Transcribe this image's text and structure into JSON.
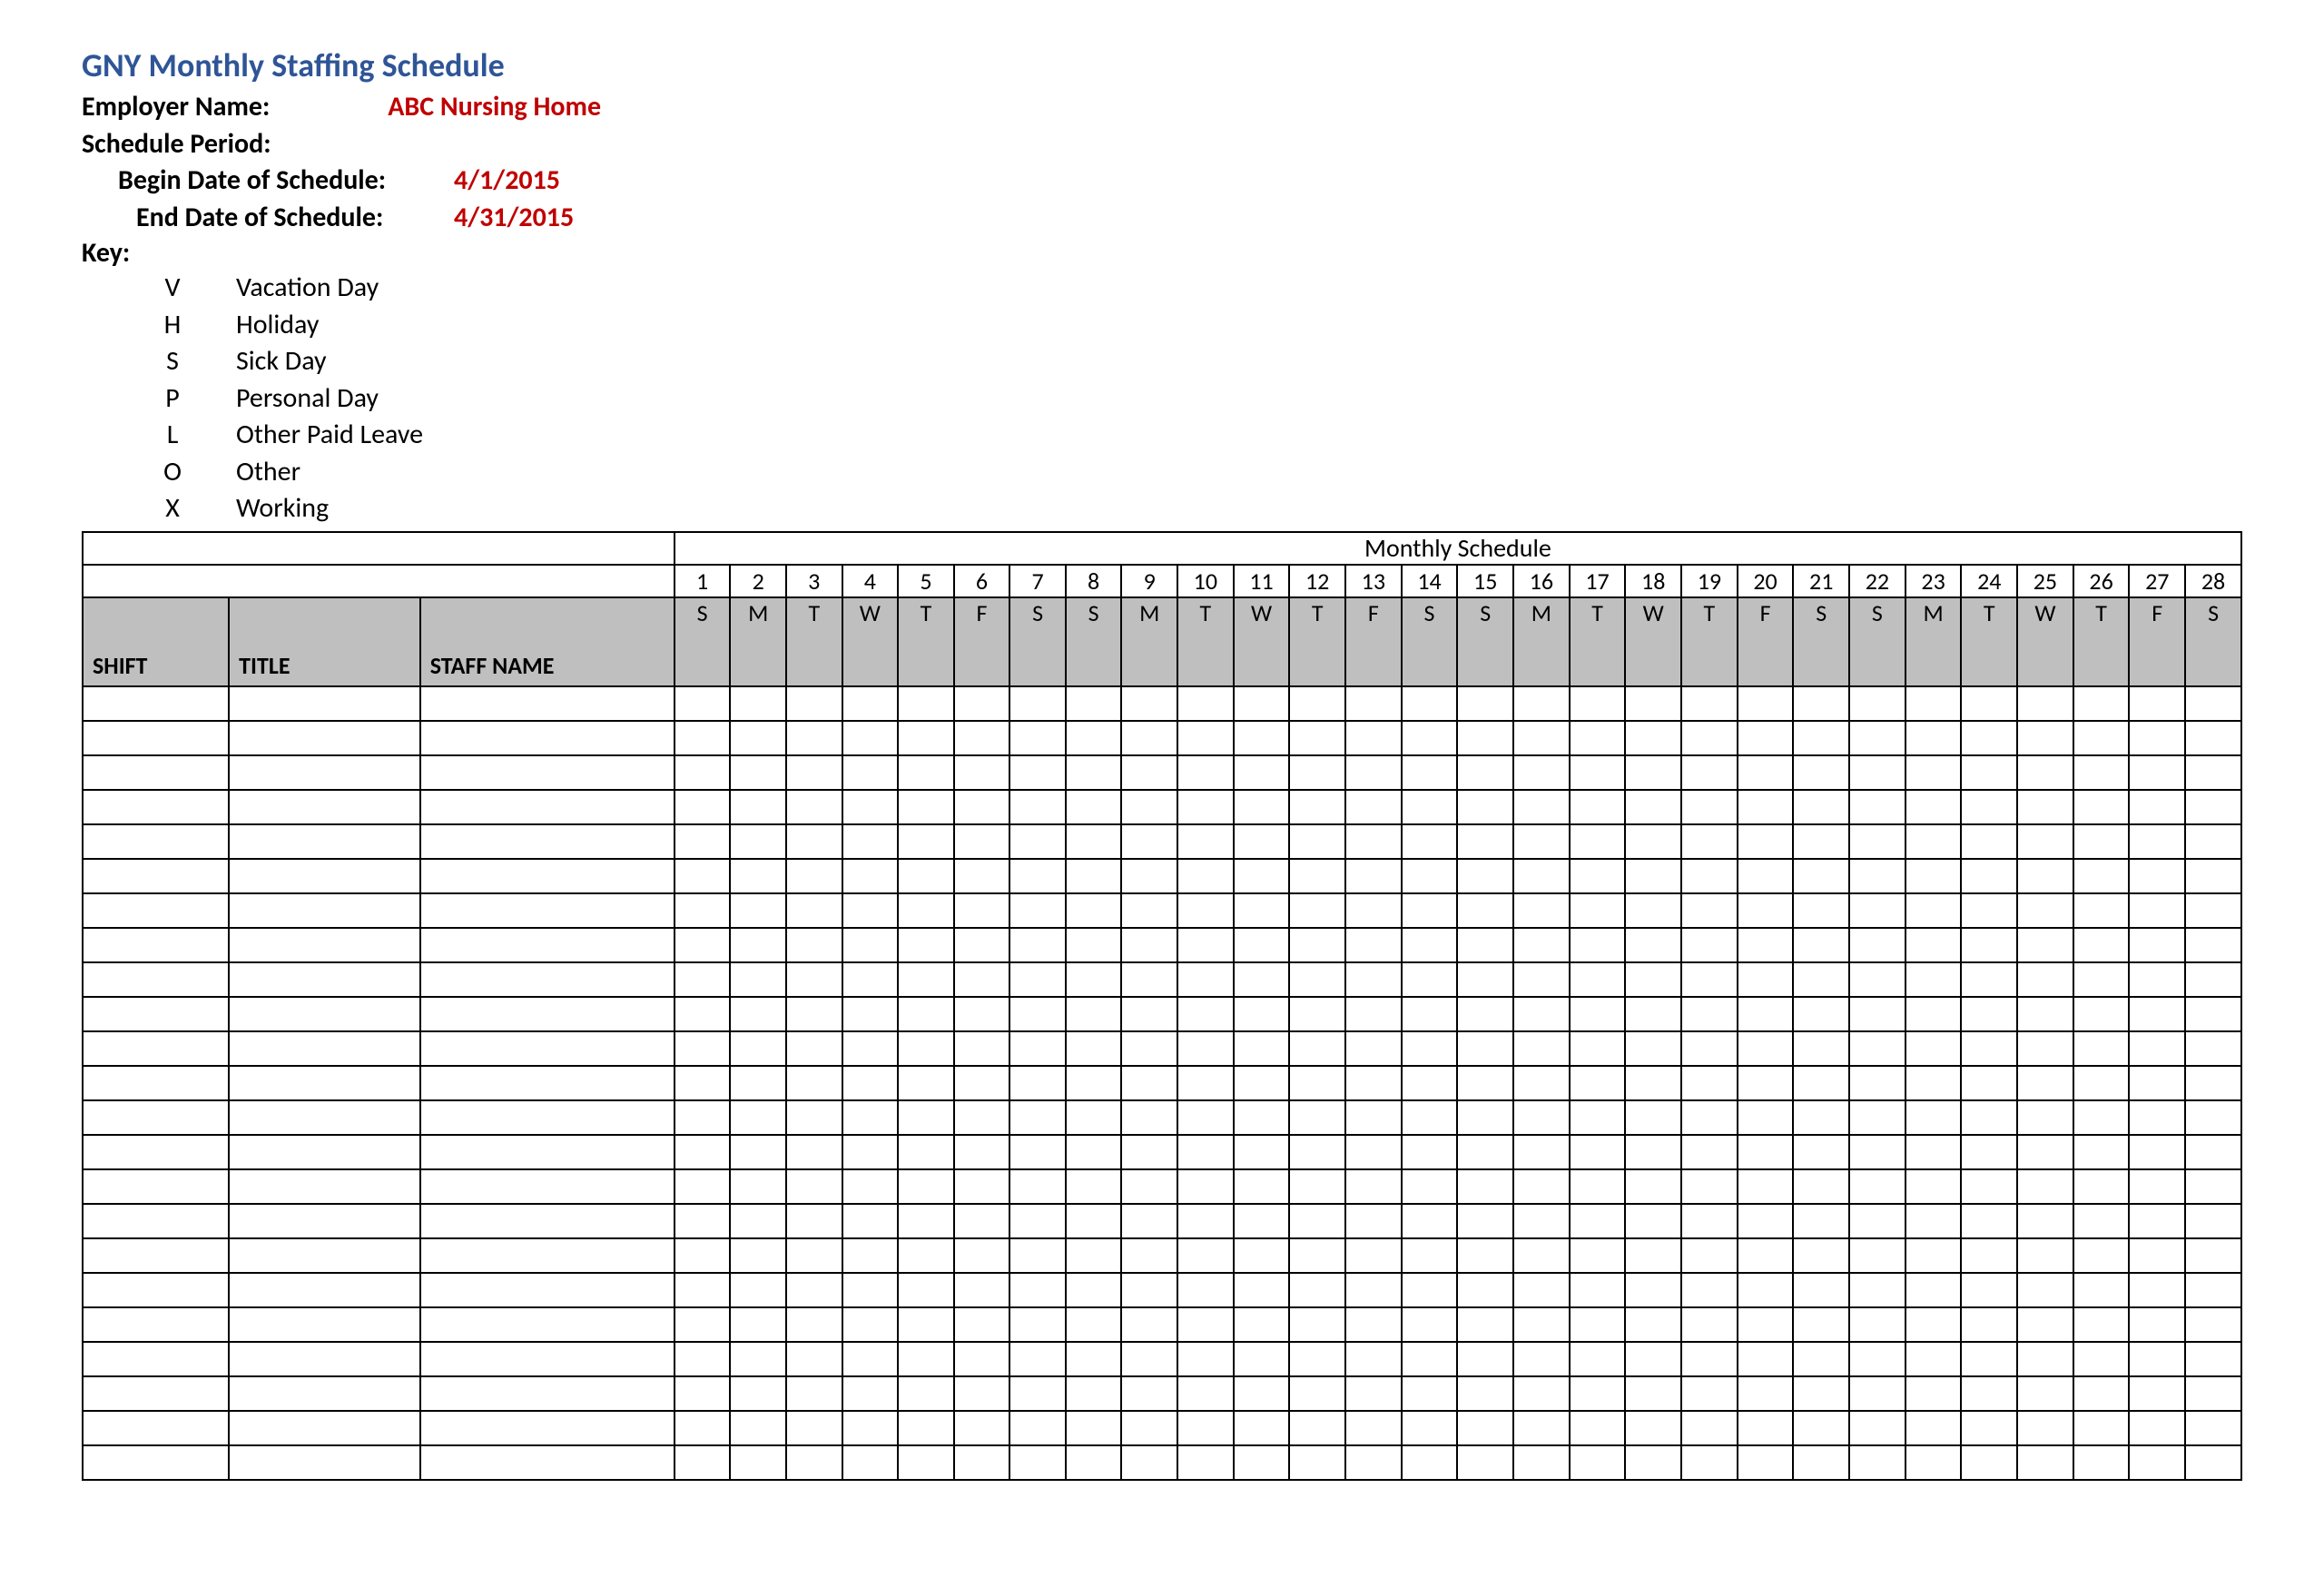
{
  "header": {
    "title": "GNY Monthly Staffing Schedule",
    "employer_label": "Employer Name:",
    "employer_value": "ABC Nursing Home",
    "period_label": "Schedule Period:",
    "begin_label": "Begin Date of Schedule:",
    "begin_value": "4/1/2015",
    "end_label": "End Date of Schedule:",
    "end_value": "4/31/2015",
    "key_label": "Key:",
    "key": [
      {
        "code": "V",
        "text": "Vacation Day"
      },
      {
        "code": "H",
        "text": "Holiday"
      },
      {
        "code": "S",
        "text": "Sick Day"
      },
      {
        "code": "P",
        "text": "Personal Day"
      },
      {
        "code": "L",
        "text": "Other Paid Leave"
      },
      {
        "code": "O",
        "text": "Other"
      },
      {
        "code": "X",
        "text": "Working"
      }
    ]
  },
  "table": {
    "monthly_title": "Monthly Schedule",
    "col_shift": "SHIFT",
    "col_title": "TITLE",
    "col_name": "STAFF NAME",
    "days": [
      1,
      2,
      3,
      4,
      5,
      6,
      7,
      8,
      9,
      10,
      11,
      12,
      13,
      14,
      15,
      16,
      17,
      18,
      19,
      20,
      21,
      22,
      23,
      24,
      25,
      26,
      27,
      28
    ],
    "dow": [
      "S",
      "M",
      "T",
      "W",
      "T",
      "F",
      "S",
      "S",
      "M",
      "T",
      "W",
      "T",
      "F",
      "S",
      "S",
      "M",
      "T",
      "W",
      "T",
      "F",
      "S",
      "S",
      "M",
      "T",
      "W",
      "T",
      "F",
      "S"
    ],
    "blank_rows": 23
  }
}
